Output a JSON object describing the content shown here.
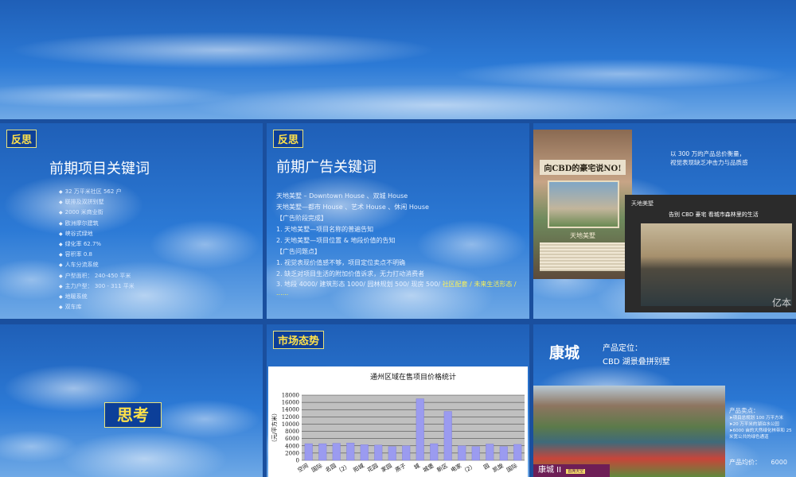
{
  "slides": {
    "reflect1": {
      "tag": "反思",
      "title": "前期项目关键词",
      "items": [
        "32 万平米社区 562 户",
        "联排及双拼别墅",
        "2000 米商业街",
        "欧洲摩尔建筑",
        "峡谷式绿地",
        "绿化率 62.7%",
        "容积率 0.8",
        "人车分流系统",
        "户型面积： 240-450 平米",
        "主力户型： 300 - 311 平米",
        "地暖系统",
        "双车库"
      ]
    },
    "reflect2": {
      "tag": "反思",
      "title": "前期广告关键词",
      "lines": [
        "天地美墅 – Downtown House 、双城 House",
        "天地美墅—都市 House 、艺术 House 、休闲 House",
        "【广告阶段完成】",
        "1.    天地美墅—项目名称的普遍告知",
        "2.    天地美墅—项目位置 & 地段价值的告知",
        "【广告问题点】",
        "1.    视觉表现价值感不够，项目定位卖点不明确",
        "2.    缺乏对项目生活的附加价值诉求，无力打动消费者"
      ],
      "last_line_prefix": "3.    地段 4000/ 建筑形态 1000/ 园林规划 500/ 现房 500/ ",
      "last_line_highlight": "社区配套 / 未来生活形态 / ......"
    },
    "ads": {
      "note_line1": "以 300 万的产品总价衡量，",
      "note_line2": "视觉表现缺乏冲击力与品质感",
      "ad1_headline": "向CBD的豪宅说NO!",
      "ad1_sub": "天地美墅",
      "ad2_brand": "天地美墅",
      "ad2_headline": "告别 CBD 豪宅  看城市森林里的生活",
      "watermark": "亿本"
    },
    "think": {
      "word": "思考"
    },
    "market": {
      "tag": "市场态势",
      "bar_color": "#9b9bf0",
      "plot_bg": "#c0c0c0"
    },
    "kangcheng": {
      "name": "康城",
      "position_label": "产品定位：",
      "position_value": "CBD 湖景叠拼别墅",
      "photo_caption": "康城 II",
      "photo_badge": "首席天空",
      "features_title": "产品卖点：",
      "features": [
        "➤项目总规划 100 万平方米",
        "➤20 万平米的湖泊水公园",
        "➤6000 亩的大然绿化林带和 25 米宽公共的绿色通道"
      ],
      "price_label": "产品均价：",
      "price_value": "6000"
    }
  },
  "chart_data": {
    "type": "bar",
    "title": "通州区域在售项目价格统计",
    "ylabel": "（元/平方米）",
    "ylim": [
      0,
      18000
    ],
    "yticks": [
      0,
      2000,
      4000,
      6000,
      8000,
      10000,
      12000,
      14000,
      16000,
      18000
    ],
    "grid": true,
    "categories_visible": [
      "空间",
      "国际",
      "名园",
      "（2）",
      "阳城",
      "花园",
      "家园",
      "燕子",
      "城",
      "城堡",
      "新区",
      "电家",
      "（2）",
      "园",
      "凯旋",
      "国际"
    ],
    "values": [
      4600,
      4600,
      4700,
      4800,
      4300,
      4200,
      3800,
      4000,
      17000,
      4600,
      13500,
      4000,
      3800,
      4500,
      3800,
      4400
    ]
  }
}
